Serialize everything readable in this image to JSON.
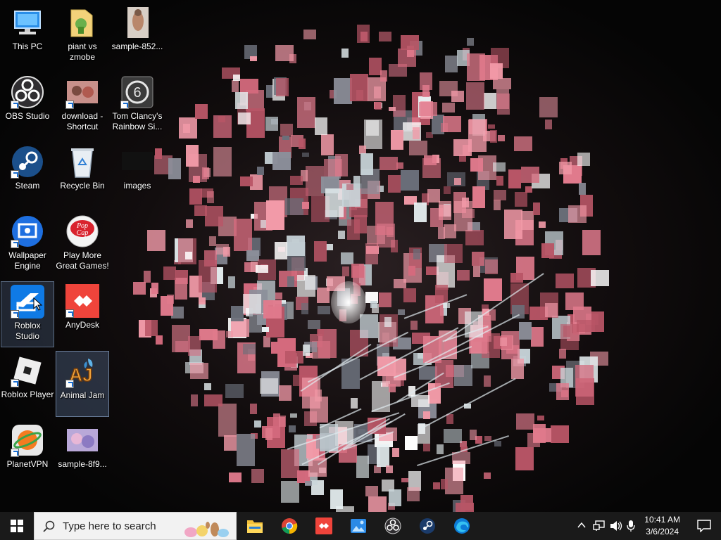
{
  "desktop": {
    "icons": [
      {
        "label": "This PC",
        "icon": "this-pc-icon"
      },
      {
        "label": "piant vs zmobe",
        "icon": "folder-icon"
      },
      {
        "label": "sample-852...",
        "icon": "image-file-icon"
      },
      {
        "label": "OBS Studio",
        "icon": "obs-studio-icon"
      },
      {
        "label": "download - Shortcut",
        "icon": "image-shortcut-icon"
      },
      {
        "label": "Tom Clancy's Rainbow Si...",
        "icon": "rainbow-six-icon"
      },
      {
        "label": "Steam",
        "icon": "steam-icon"
      },
      {
        "label": "Recycle Bin",
        "icon": "recycle-bin-icon"
      },
      {
        "label": "images",
        "icon": "image-file-icon"
      },
      {
        "label": "Wallpaper Engine",
        "icon": "wallpaper-engine-icon"
      },
      {
        "label": "Play More Great Games!",
        "icon": "popcap-icon"
      },
      {
        "label": "Roblox Studio",
        "icon": "roblox-studio-icon"
      },
      {
        "label": "AnyDesk",
        "icon": "anydesk-icon"
      },
      {
        "label": "Roblox Player",
        "icon": "roblox-player-icon"
      },
      {
        "label": "Animal Jam",
        "icon": "animal-jam-icon"
      },
      {
        "label": "PlanetVPN",
        "icon": "planetvpn-icon"
      },
      {
        "label": "sample-8f9...",
        "icon": "image-file-icon"
      }
    ]
  },
  "taskbar": {
    "search_placeholder": "Type here to search",
    "pinned": [
      "file-explorer-icon",
      "chrome-icon",
      "anydesk-icon",
      "photos-icon",
      "obs-studio-icon",
      "steam-icon",
      "edge-icon"
    ],
    "clock_time": "10:41 AM",
    "clock_date": "3/6/2024"
  },
  "colors": {
    "taskbar_bg": "#1a1a1a",
    "accent_pink": "#e07a8c",
    "selection": "#6e8fc8"
  }
}
